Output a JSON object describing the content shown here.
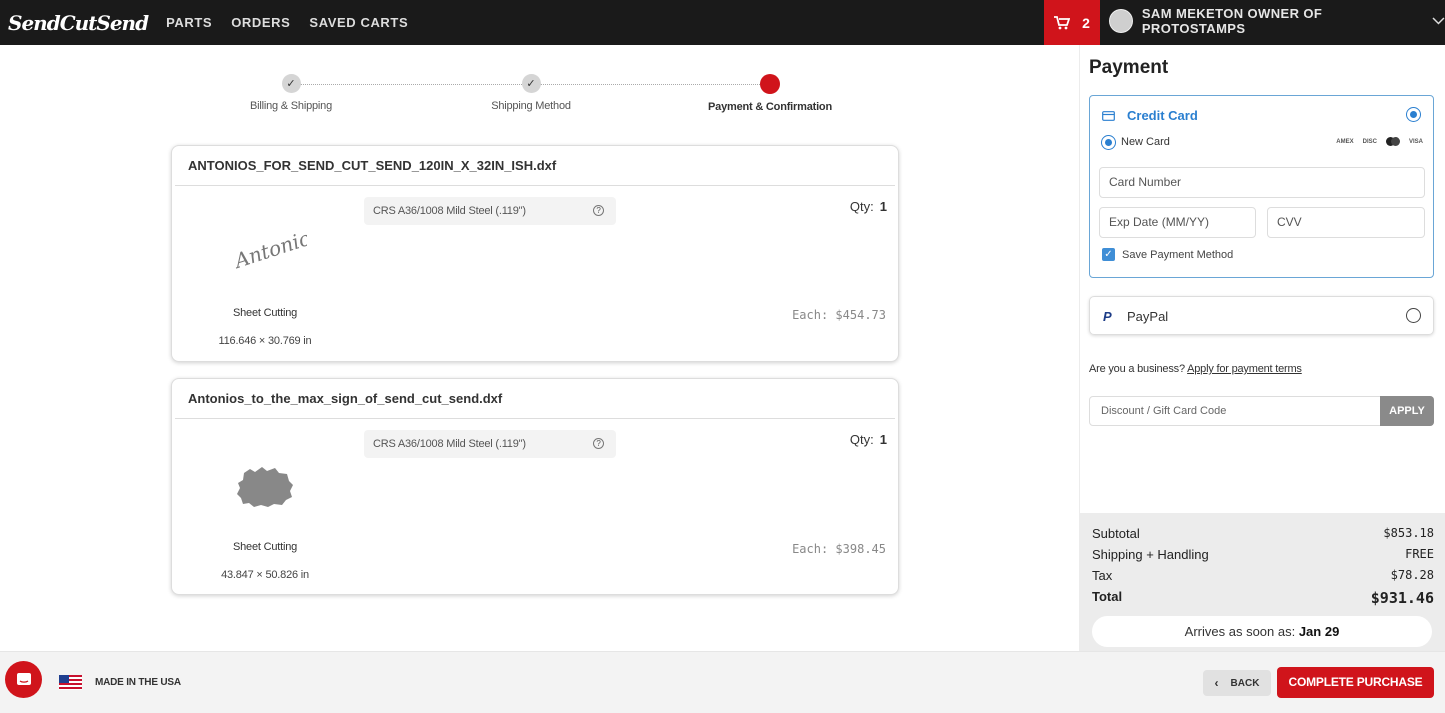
{
  "brand": {
    "logo_text": "SendCutSend"
  },
  "nav": {
    "items": [
      "PARTS",
      "ORDERS",
      "SAVED CARTS"
    ]
  },
  "cart": {
    "count": "2",
    "icon": "cart-icon"
  },
  "user": {
    "name": "SAM MEKETON OWNER OF PROTOSTAMPS"
  },
  "steps": [
    {
      "label": "Billing & Shipping",
      "state": "done"
    },
    {
      "label": "Shipping Method",
      "state": "done"
    },
    {
      "label": "Payment & Confirmation",
      "state": "active"
    }
  ],
  "parts": [
    {
      "filename": "ANTONIOS_FOR_SEND_CUT_SEND_120IN_X_32IN_ISH.dxf",
      "process": "Sheet Cutting",
      "dimensions": "116.646 × 30.769 in",
      "material": "CRS A36/1008 Mild Steel (.119\")",
      "qty_label": "Qty:",
      "qty": "1",
      "each": "Each: $454.73",
      "thumb_text": "Antonio's"
    },
    {
      "filename": "Antonios_to_the_max_sign_of_send_cut_send.dxf",
      "process": "Sheet Cutting",
      "dimensions": "43.847 × 50.826 in",
      "material": "CRS A36/1008 Mild Steel (.119\")",
      "qty_label": "Qty:",
      "qty": "1",
      "each": "Each: $398.45"
    }
  ],
  "payment": {
    "title": "Payment",
    "credit_card": {
      "label": "Credit Card",
      "new_card": "New Card",
      "card_number_placeholder": "Card Number",
      "exp_placeholder": "Exp Date (MM/YY)",
      "cvv_placeholder": "CVV",
      "save_label": "Save Payment Method",
      "brands": [
        "AMEX",
        "DISC",
        "MC",
        "VISA"
      ]
    },
    "paypal": {
      "label": "PayPal",
      "icon_letter": "P"
    },
    "business": {
      "prefix": "Are you a business? ",
      "link": "Apply for payment terms"
    },
    "discount": {
      "placeholder": "Discount / Gift Card Code",
      "apply": "APPLY"
    }
  },
  "summary": {
    "subtotal_label": "Subtotal",
    "subtotal": "$853.18",
    "shipping_label": "Shipping + Handling",
    "shipping": "FREE",
    "tax_label": "Tax",
    "tax": "$78.28",
    "total_label": "Total",
    "total": "$931.46",
    "arrives_prefix": "Arrives as soon as: ",
    "arrives_date": "Jan 29"
  },
  "footer": {
    "made_in": "MADE IN THE USA",
    "back": "BACK",
    "complete": "COMPLETE PURCHASE"
  },
  "colors": {
    "brand_red": "#d0141b",
    "accent_blue": "#2a7fd0",
    "nav_bg": "#1a1a1a"
  }
}
